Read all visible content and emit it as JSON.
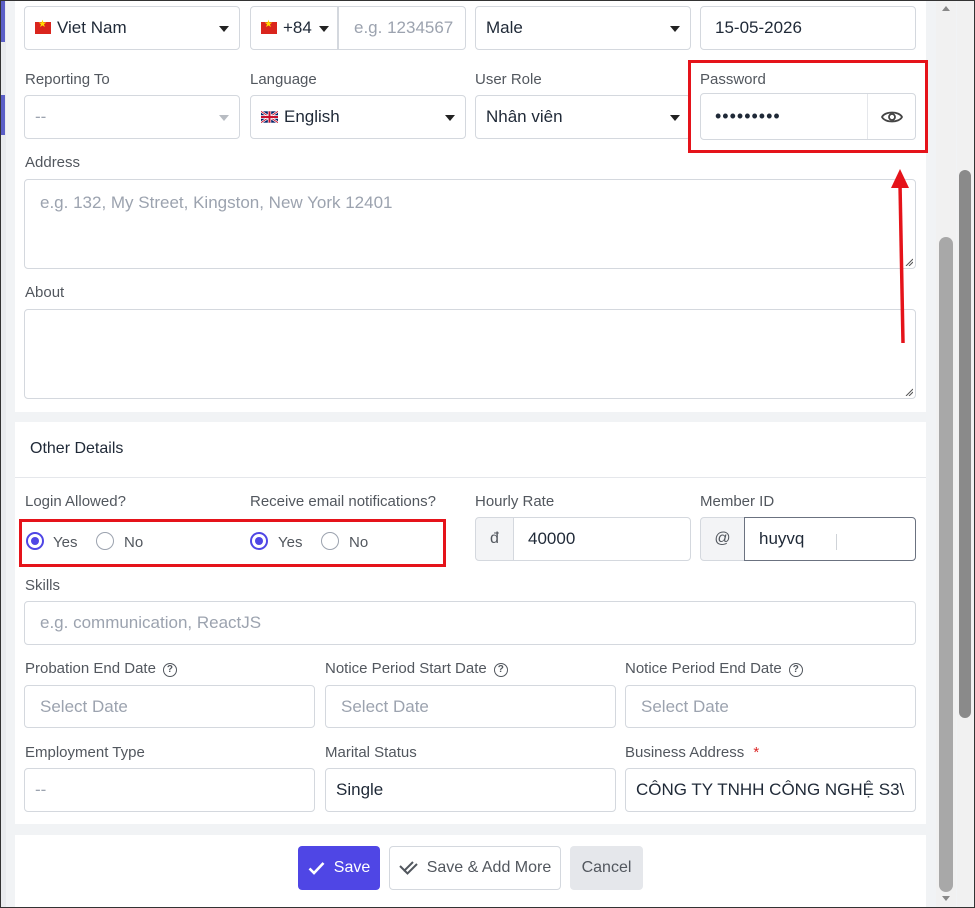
{
  "row1": {
    "country": "Viet Nam",
    "phone_code": "+84",
    "phone_placeholder": "e.g. 1234567",
    "gender": "Male",
    "birth_date": "15-05-2026"
  },
  "row2": {
    "reporting_to_label": "Reporting To",
    "reporting_to_value": "--",
    "language_label": "Language",
    "language_value": "English",
    "user_role_label": "User Role",
    "user_role_value": "Nhân viên",
    "password_label": "Password",
    "password_value": "•••••••••"
  },
  "address": {
    "label": "Address",
    "placeholder": "e.g. 132, My Street, Kingston, New York 12401"
  },
  "about": {
    "label": "About"
  },
  "other_details": {
    "title": "Other Details",
    "login_allowed_label": "Login Allowed?",
    "login_yes": "Yes",
    "login_no": "No",
    "email_notif_label": "Receive email notifications?",
    "email_yes": "Yes",
    "email_no": "No",
    "hourly_rate_label": "Hourly Rate",
    "currency_symbol": "đ",
    "hourly_rate_value": "40000",
    "member_id_label": "Member ID",
    "member_id_prefix": "@",
    "member_id_value": "huyvq",
    "skills_label": "Skills",
    "skills_placeholder": "e.g. communication, ReactJS",
    "probation_label": "Probation End Date",
    "notice_start_label": "Notice Period Start Date",
    "notice_end_label": "Notice Period End Date",
    "date_placeholder": "Select Date",
    "employment_type_label": "Employment Type",
    "employment_type_value": "--",
    "marital_status_label": "Marital Status",
    "marital_status_value": "Single",
    "business_address_label": "Business Address",
    "required_mark": "*",
    "business_address_value": "CÔNG TY TNHH CÔNG NGHỆ S3\\"
  },
  "actions": {
    "save": "Save",
    "save_add_more": "Save & Add More",
    "cancel": "Cancel"
  },
  "colors": {
    "accent": "#4f46e5",
    "annotation_red": "#e5131a"
  }
}
